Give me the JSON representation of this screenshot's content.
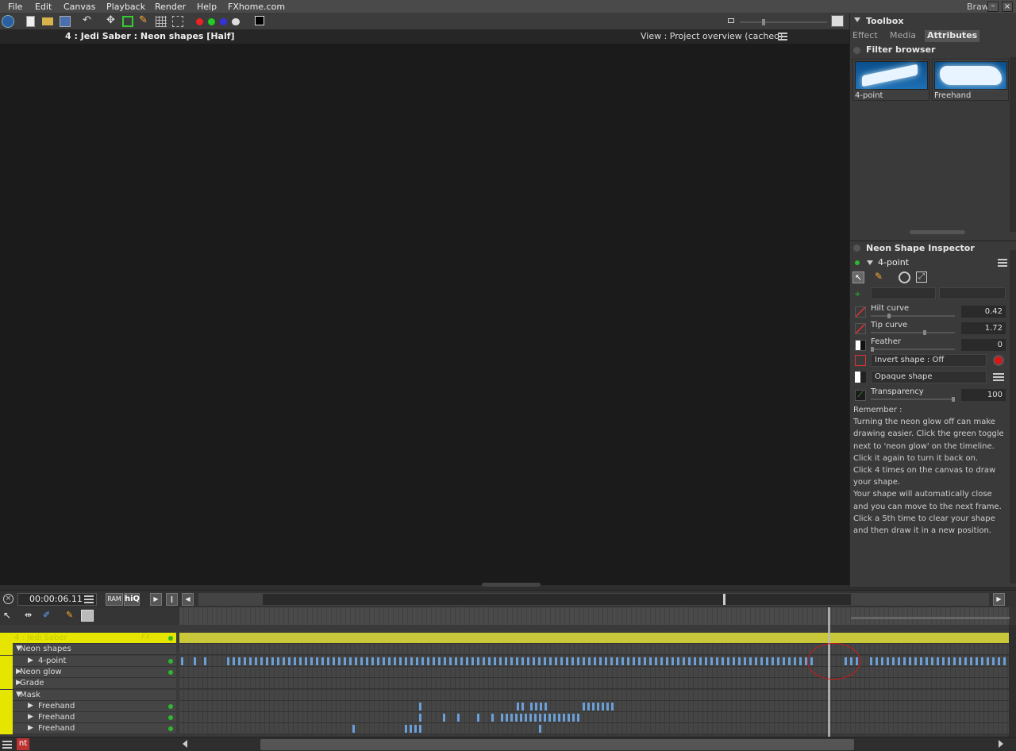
{
  "menu": {
    "items": [
      "File",
      "Edit",
      "Canvas",
      "Playback",
      "Render",
      "Help",
      "FXhome.com"
    ],
    "user": "Brawl"
  },
  "canvas": {
    "title": "4 : Jedi Saber : Neon shapes [Half]",
    "view_label": "View : Project overview (cached)"
  },
  "toolbox": {
    "title": "Toolbox",
    "tabs": [
      "Effect",
      "Media",
      "Attributes"
    ],
    "active_tab": "Attributes"
  },
  "filter_browser": {
    "title": "Filter browser",
    "items": [
      {
        "label": "4-point",
        "icon": "saber-4point-icon"
      },
      {
        "label": "Freehand",
        "icon": "freehand-shape-icon"
      }
    ]
  },
  "inspector": {
    "title": "Neon Shape Inspector",
    "shape_name": "4-point",
    "params": [
      {
        "name": "Hilt curve",
        "value": "0.42",
        "level": 0.21
      },
      {
        "name": "Tip curve",
        "value": "1.72",
        "level": 0.65
      },
      {
        "name": "Feather",
        "value": "0",
        "level": 0.0
      }
    ],
    "invert_label": "Invert shape : Off",
    "opaque_label": "Opaque shape",
    "transparency": {
      "name": "Transparency",
      "value": "100",
      "level": 1.0
    },
    "help_lines": [
      "Remember :",
      "Turning the neon glow off can make",
      "drawing easier. Click the green toggle",
      "next to 'neon glow' on the timeline.",
      "Click it again to turn it back on.",
      "Click 4 times on the canvas to draw",
      "your shape.",
      "Your shape will automatically close",
      "and you can move to the next frame.",
      "Click a 5th time to clear your shape",
      "and then draw it in a new position."
    ]
  },
  "transport": {
    "timecode": "00:00:06.11",
    "ram_label": "RAM",
    "hiq_label": "hiQ"
  },
  "timeline": {
    "tracks": [
      {
        "name": "4 : Jedi Saber",
        "indent": 0,
        "type": "layer",
        "tag": "FX"
      },
      {
        "name": "Neon shapes",
        "indent": 1,
        "type": "group",
        "expanded": true
      },
      {
        "name": "4-point",
        "indent": 2,
        "type": "item",
        "dot": true
      },
      {
        "name": "Neon glow",
        "indent": 1,
        "type": "group",
        "expanded": false,
        "dot": true
      },
      {
        "name": "Grade",
        "indent": 1,
        "type": "group",
        "expanded": false
      },
      {
        "name": "Mask",
        "indent": 1,
        "type": "group",
        "expanded": true
      },
      {
        "name": "Freehand",
        "indent": 2,
        "type": "item",
        "dot": true
      },
      {
        "name": "Freehand",
        "indent": 2,
        "type": "item",
        "dot": true
      },
      {
        "name": "Freehand",
        "indent": 2,
        "type": "item",
        "dot": true
      }
    ]
  },
  "status": {
    "label": "nt"
  },
  "colors": {
    "layer_yellow": "#e5e500",
    "keyframe_blue": "#6a9fd8",
    "toggle_green": "#2db82d",
    "annotation_red": "#d01818"
  }
}
